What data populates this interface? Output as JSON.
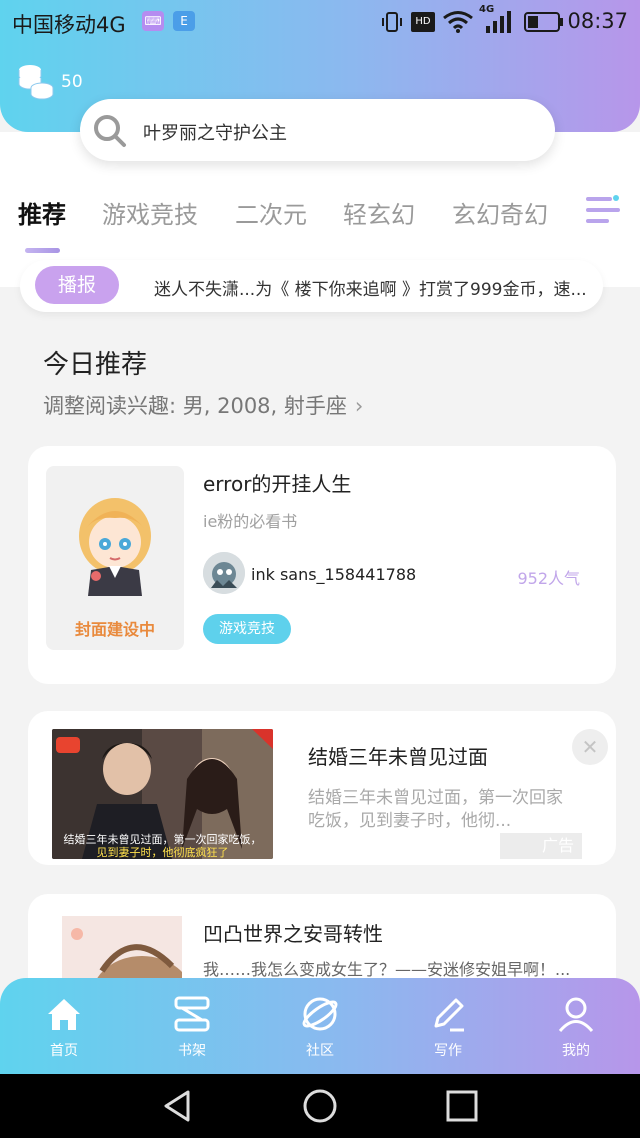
{
  "status_bar": {
    "carrier": "中国移动4G",
    "network_type": "4G",
    "time": "08:37",
    "hd_label": "HD"
  },
  "header": {
    "coin_count": "50",
    "search_placeholder": "叶罗丽之守护公主"
  },
  "tabs": [
    "推荐",
    "游戏竞技",
    "二次元",
    "轻玄幻",
    "玄幻奇幻"
  ],
  "broadcast": {
    "label": "播报",
    "text": "迷人不失潇...为《 楼下你来追啊 》打赏了999金币，速..."
  },
  "today": {
    "title": "今日推荐",
    "subtitle": "调整阅读兴趣: 男, 2008, 射手座"
  },
  "featured_book": {
    "cover_text": "封面建设中",
    "title": "error的开挂人生",
    "description": "ie粉的必看书",
    "author": "ink sans_158441788",
    "popularity": "952人气",
    "genre": "游戏竞技"
  },
  "ad_card": {
    "title": "结婚三年未曾见过面",
    "description": "结婚三年未曾见过面，第一次回家吃饭，见到妻子时，他彻...",
    "caption_line1": "结婚三年未曾见过面，第一次回家吃饭，",
    "caption_line2": "见到妻子时，他彻底疯狂了",
    "ad_label": "广告"
  },
  "book2": {
    "title": "凹凸世界之安哥转性",
    "description": "我……我怎么变成女生了？——安迷修安姐早啊！..."
  },
  "bottom_nav": [
    "首页",
    "书架",
    "社区",
    "写作",
    "我的"
  ],
  "colors": {
    "gradient_start": "#5fd3ee",
    "gradient_end": "#b796ea",
    "broadcast_pill": "#c9a2ee",
    "genre_tag": "#5ed1ec",
    "popularity": "#c1a6ea"
  }
}
